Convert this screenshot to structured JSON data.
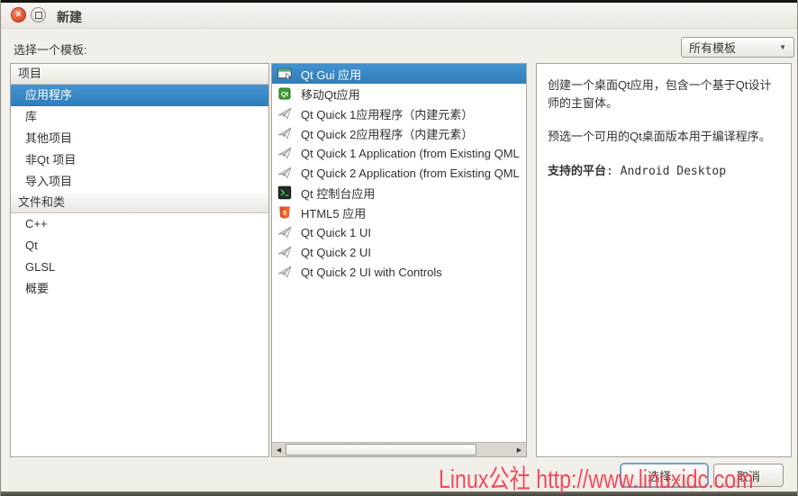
{
  "window": {
    "title": "新建"
  },
  "icons": {
    "close": "×",
    "dropdown": "▼",
    "scroll_left": "◀",
    "scroll_right": "▶"
  },
  "toolbar": {
    "label": "选择一个模板:",
    "filter_value": "所有模板"
  },
  "sidebar": {
    "sections": [
      {
        "header": "项目",
        "items": [
          {
            "label": "应用程序",
            "selected": true
          },
          {
            "label": "库",
            "selected": false
          },
          {
            "label": "其他项目",
            "selected": false
          },
          {
            "label": "非Qt 项目",
            "selected": false
          },
          {
            "label": "导入项目",
            "selected": false
          }
        ]
      },
      {
        "header": "文件和类",
        "items": [
          {
            "label": "C++",
            "selected": false
          },
          {
            "label": "Qt",
            "selected": false
          },
          {
            "label": "GLSL",
            "selected": false
          },
          {
            "label": "概要",
            "selected": false
          }
        ]
      }
    ]
  },
  "templates": {
    "items": [
      {
        "label": "Qt Gui 应用",
        "icon": "gui-window-icon",
        "selected": true
      },
      {
        "label": "移动Qt应用",
        "icon": "mobile-qt-icon",
        "selected": false
      },
      {
        "label": "Qt Quick 1应用程序（内建元素）",
        "icon": "qt-quick-plane-icon",
        "selected": false
      },
      {
        "label": "Qt Quick 2应用程序（内建元素）",
        "icon": "qt-quick-plane-icon",
        "selected": false
      },
      {
        "label": "Qt Quick 1 Application (from Existing QML",
        "icon": "qt-quick-plane-icon",
        "selected": false
      },
      {
        "label": "Qt Quick 2 Application (from Existing QML",
        "icon": "qt-quick-plane-icon",
        "selected": false
      },
      {
        "label": "Qt 控制台应用",
        "icon": "console-icon",
        "selected": false
      },
      {
        "label": "HTML5 应用",
        "icon": "html5-icon",
        "selected": false
      },
      {
        "label": "Qt Quick 1 UI",
        "icon": "qt-quick-plane-icon",
        "selected": false
      },
      {
        "label": "Qt Quick 2 UI",
        "icon": "qt-quick-plane-icon",
        "selected": false
      },
      {
        "label": "Qt Quick 2 UI with Controls",
        "icon": "qt-quick-plane-icon",
        "selected": false
      }
    ]
  },
  "details": {
    "p1": "创建一个桌面Qt应用，包含一个基于Qt设计师的主窗体。",
    "p2": "预选一个可用的Qt桌面版本用于编译程序。",
    "platforms_label": "支持的平台",
    "platforms_value": ": Android Desktop"
  },
  "buttons": {
    "choose": "选择...",
    "cancel": "取消"
  },
  "watermark": {
    "text": "Linux公社 http://www.linuxidc.com",
    "color": "#f53b4e"
  },
  "colors": {
    "selection_blue": "#3789c8",
    "close_button_orange": "#df4a2e",
    "panel_border": "#a8a49c"
  }
}
